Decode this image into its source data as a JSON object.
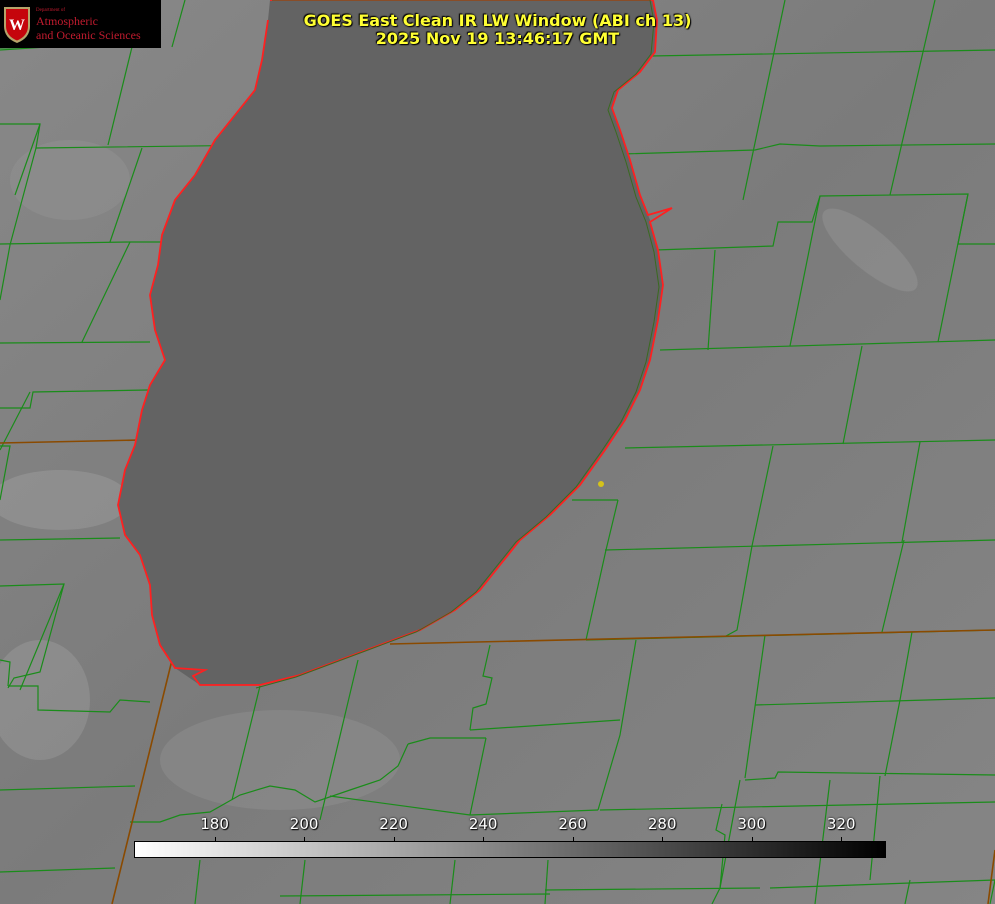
{
  "title": {
    "line1": "GOES East Clean IR LW Window (ABI ch 13)",
    "line2": "2025 Nov 19 13:46:17 GMT"
  },
  "logo": {
    "dept": "Department of",
    "line1": "Atmospheric",
    "line2": "and Oceanic Sciences",
    "seal_letter": "W"
  },
  "colorbar": {
    "min": 162,
    "max": 330,
    "ticks": [
      {
        "label": "180",
        "value": 180
      },
      {
        "label": "200",
        "value": 200
      },
      {
        "label": "220",
        "value": 220
      },
      {
        "label": "240",
        "value": 240
      },
      {
        "label": "260",
        "value": 260
      },
      {
        "label": "280",
        "value": 280
      },
      {
        "label": "300",
        "value": 300
      },
      {
        "label": "320",
        "value": 320
      }
    ]
  },
  "colors": {
    "land": "#7a7a7a",
    "lake": "#636363",
    "county_lines": "#1a8c1a",
    "state_lines": "#8a4a00",
    "shoreline": "#ff2020",
    "title": "#ffff33",
    "marker": "#d4c21a"
  },
  "icons": {
    "logo_seal": "uw-crest-icon",
    "marker": "location-dot-icon"
  }
}
